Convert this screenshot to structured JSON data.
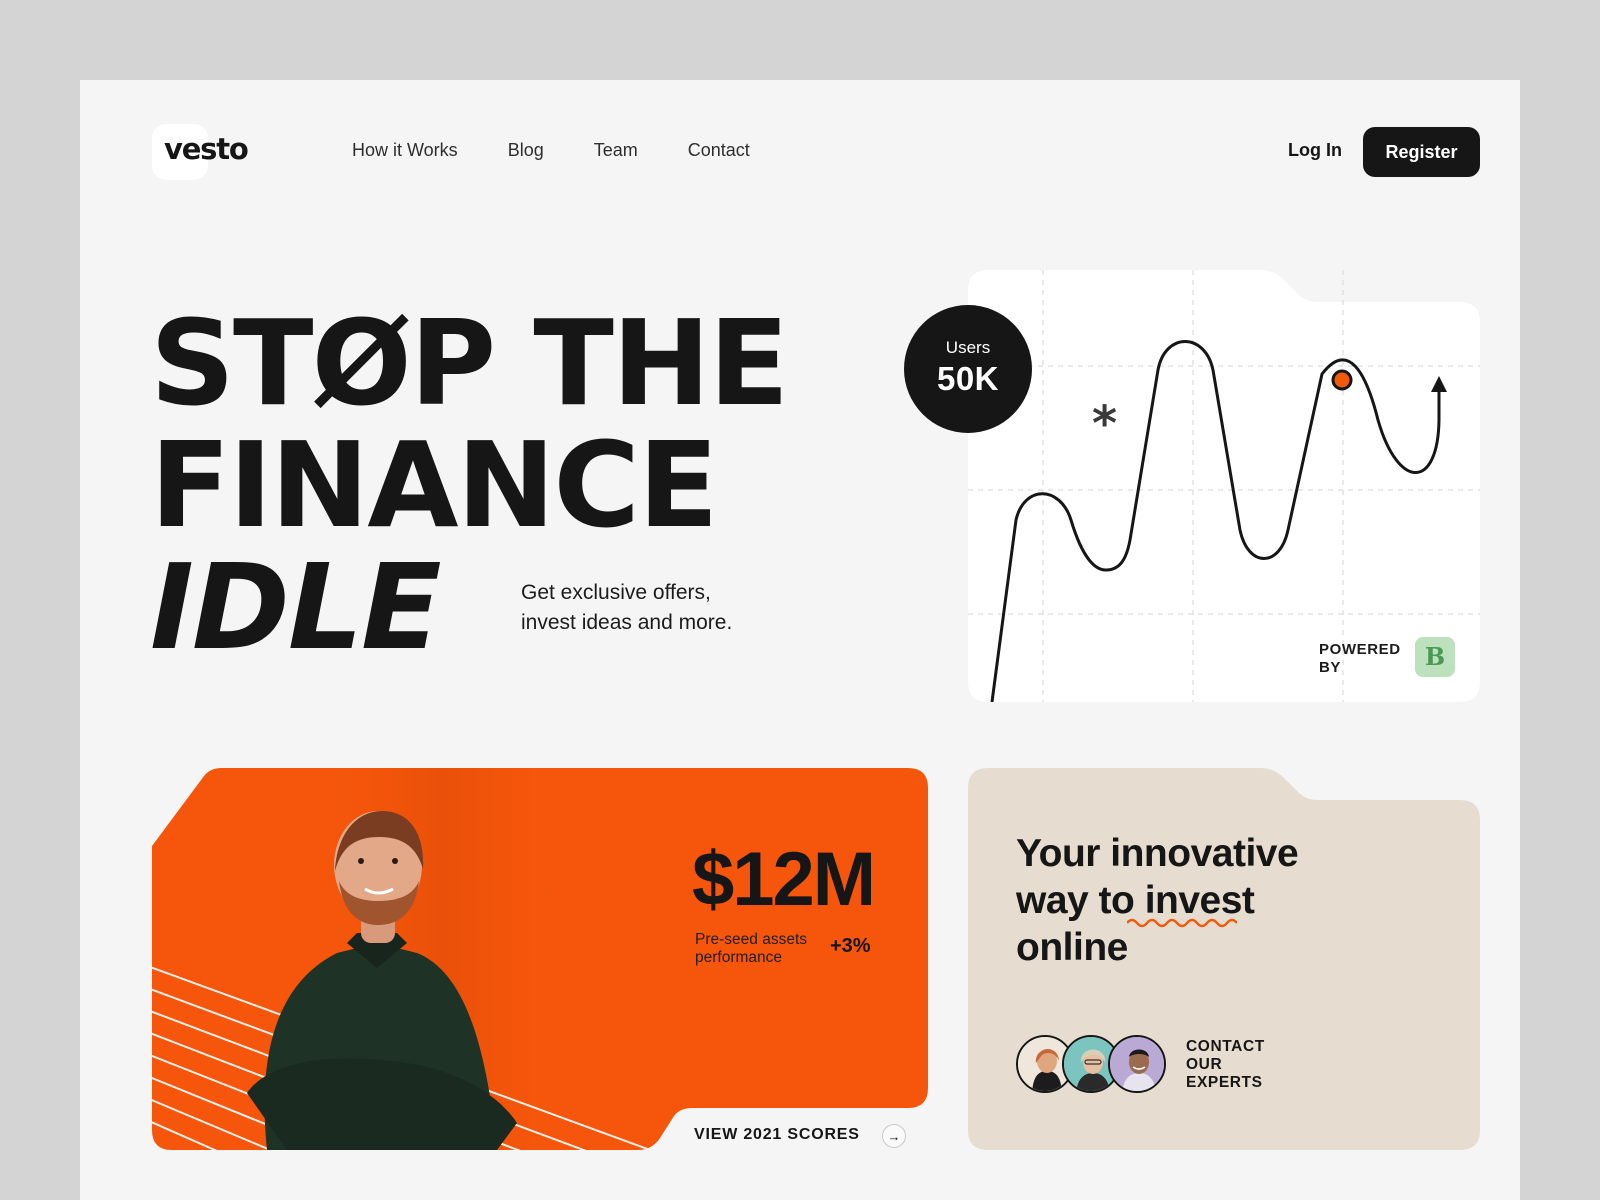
{
  "brand": {
    "name": "vesto"
  },
  "nav": {
    "items": [
      {
        "label": "How it Works"
      },
      {
        "label": "Blog"
      },
      {
        "label": "Team"
      },
      {
        "label": "Contact"
      }
    ]
  },
  "auth": {
    "login_label": "Log In",
    "register_label": "Register"
  },
  "hero": {
    "headline": [
      "STØP THE",
      "FINANCE",
      "IDLE"
    ],
    "tagline": [
      "Get exclusive offers,",
      "invest ideas and more."
    ]
  },
  "chart_card": {
    "users_label": "Users",
    "users_value": "50K",
    "powered_by": [
      "POWERED",
      "BY"
    ],
    "partner_logo_letter": "B",
    "accent_color": "#f15a0b"
  },
  "funding_card": {
    "amount": "$12M",
    "label": [
      "Pre-seed assets",
      "performance"
    ],
    "delta": "+3%",
    "cta": "VIEW 2021 SCORES",
    "background_color": "#f5560b"
  },
  "invest_card": {
    "title": [
      "Your innovative",
      "way to invest",
      "online"
    ],
    "cta": [
      "CONTACT",
      "OUR",
      "EXPERTS"
    ],
    "background_color": "#e6ddd0"
  },
  "icons": {
    "arrow": "arrow-right-icon",
    "asterisk": "asterisk-icon"
  }
}
